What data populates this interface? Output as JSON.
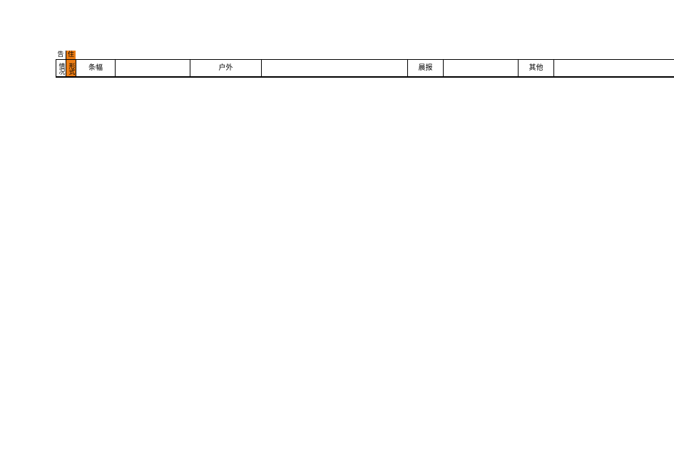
{
  "header": {
    "col0_top": "告",
    "col0_bottom": "情况",
    "col1_top": "住",
    "col1_bottom": "形式"
  },
  "columns": {
    "c1": "条幅",
    "c2": "",
    "c3": "户外",
    "c4": "",
    "c5": "晨报",
    "c6": "",
    "c7": "其他",
    "c8": ""
  }
}
